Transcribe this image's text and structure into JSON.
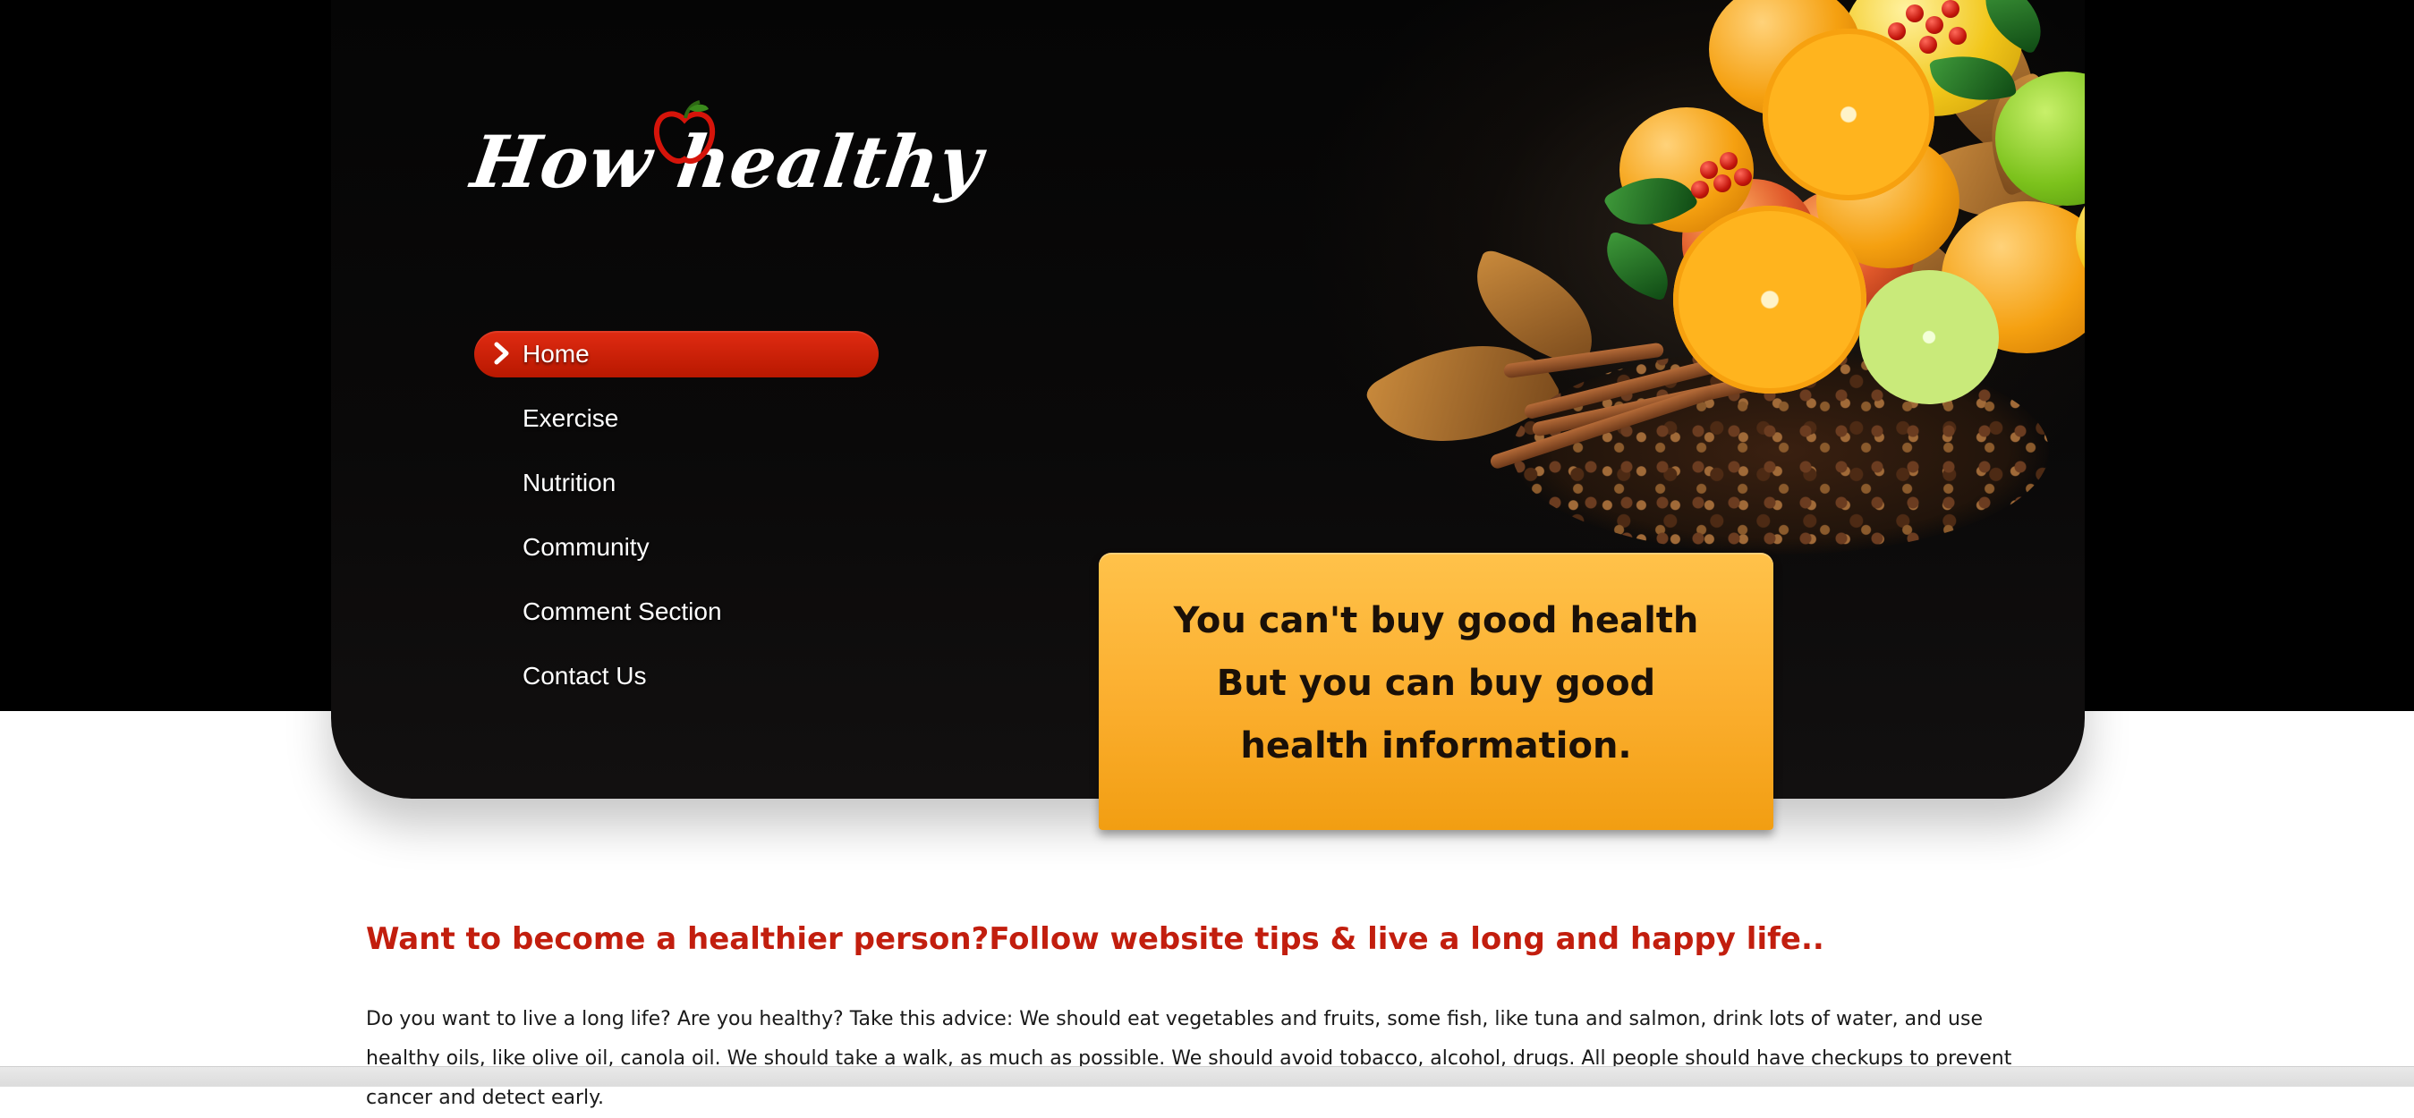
{
  "site": {
    "logo_text": "How healthy"
  },
  "nav": {
    "items": [
      {
        "label": "Home",
        "active": true
      },
      {
        "label": "Exercise",
        "active": false
      },
      {
        "label": "Nutrition",
        "active": false
      },
      {
        "label": "Community",
        "active": false
      },
      {
        "label": "Comment Section",
        "active": false
      },
      {
        "label": "Contact Us",
        "active": false
      }
    ]
  },
  "tagline": "You can't buy good health But you can buy good health information.",
  "content": {
    "headline": "Want to become a healthier person?Follow website tips & live a long and happy life..",
    "body": "Do you want to live a long life? Are you healthy? Take this advice: We should eat vegetables and fruits, some fish, like tuna and salmon, drink lots of water, and use healthy oils, like olive oil, canola oil. We should take a walk, as much as possible. We should avoid tobacco, alcohol, drugs. All people should have checkups to prevent cancer and detect early."
  },
  "colors": {
    "page_top": "#000000",
    "nav_active": "#d42410",
    "tagline_bg": "#fbae2e",
    "headline": "#c21e0e"
  },
  "icons": {
    "nav_active_marker": "chevron-right-icon",
    "logo_mark": "apple-icon"
  }
}
